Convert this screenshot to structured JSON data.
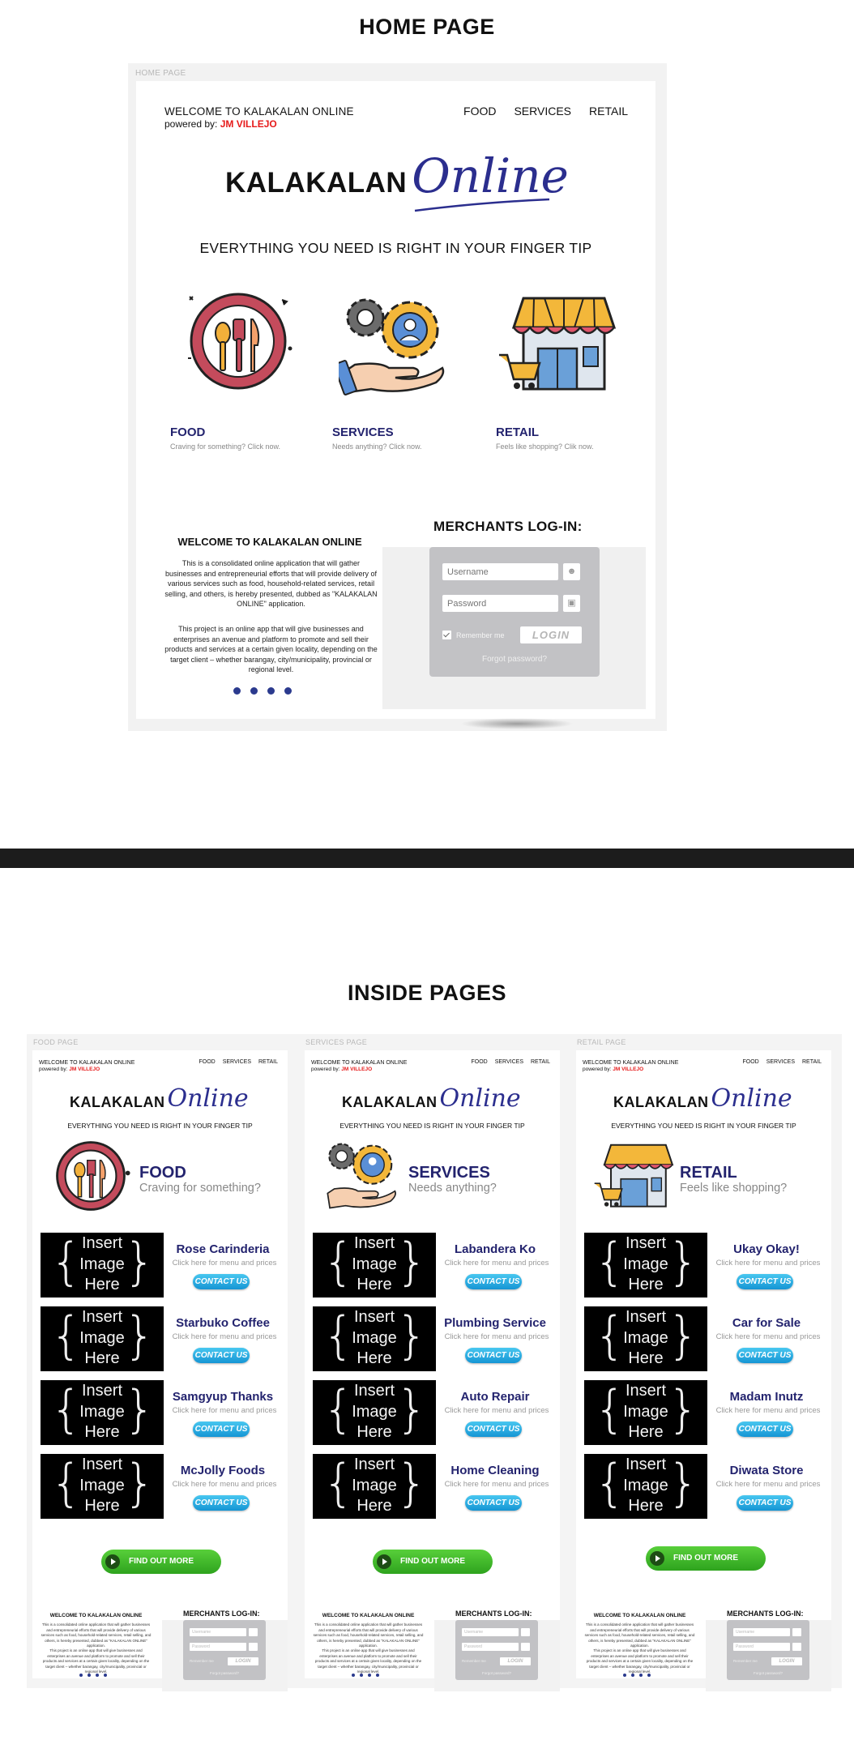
{
  "sections": {
    "home_title": "HOME PAGE",
    "inside_title": "INSIDE PAGES"
  },
  "home": {
    "frame_label": "HOME PAGE",
    "welcome": "WELCOME TO KALAKALAN ONLINE",
    "powered_prefix": "powered by:",
    "powered_name": "JM VILLEJO",
    "nav": [
      "FOOD",
      "SERVICES",
      "RETAIL"
    ],
    "logo_main": "KALAKALAN",
    "logo_script": "Online",
    "tagline": "EVERYTHING YOU NEED IS RIGHT IN YOUR FINGER TIP",
    "categories": [
      {
        "name": "FOOD",
        "sub": "Craving for something? Click now.",
        "icon": "food-plate-icon"
      },
      {
        "name": "SERVICES",
        "sub": "Needs anything? Click now.",
        "icon": "services-gears-hand-icon"
      },
      {
        "name": "RETAIL",
        "sub": "Feels like shopping? Clik now.",
        "icon": "retail-store-icon"
      }
    ],
    "about_title": "WELCOME TO KALAKALAN ONLINE",
    "about_p1": "This is a consolidated online application that will gather businesses and entrepreneurial efforts that will provide delivery of various services such as food, household-related services, retail selling, and others, is hereby presented, dubbed as \"KALAKALAN ONLINE\" application.",
    "about_p2": "This project is an online app that will give businesses and enterprises an avenue and platform to promote and sell their products and services at a certain given locality, depending on the target client – whether barangay, city/municipality, provincial or regional level.",
    "social_icons": [
      "facebook-icon",
      "linkedin-icon",
      "youtube-icon",
      "instagram-icon"
    ],
    "merchants_title": "MERCHANTS LOG-IN:",
    "login": {
      "username_placeholder": "Username",
      "password_placeholder": "Password",
      "remember": "Remember me",
      "button": "LOGIN",
      "forgot": "Forgot password?"
    }
  },
  "inside": {
    "contact_label": "CONTACT US",
    "find_out_more": "FIND OUT MORE",
    "placeholder_lines": [
      "Insert",
      "Image",
      "Here"
    ],
    "row_sub": "Click here for menu and prices",
    "pages": [
      {
        "frame_label": "FOOD PAGE",
        "category": "FOOD",
        "category_sub": "Craving for something?",
        "rows": [
          "Rose Carinderia",
          "Starbuko Coffee",
          "Samgyup Thanks",
          "McJolly Foods"
        ]
      },
      {
        "frame_label": "SERVICES PAGE",
        "category": "SERVICES",
        "category_sub": "Needs anything?",
        "rows": [
          "Labandera Ko",
          "Plumbing Service",
          "Auto Repair",
          "Home Cleaning"
        ]
      },
      {
        "frame_label": "RETAIL PAGE",
        "category": "RETAIL",
        "category_sub": "Feels like shopping?",
        "rows": [
          "Ukay Okay!",
          "Car for Sale",
          "Madam Inutz",
          "Diwata Store"
        ]
      }
    ]
  }
}
